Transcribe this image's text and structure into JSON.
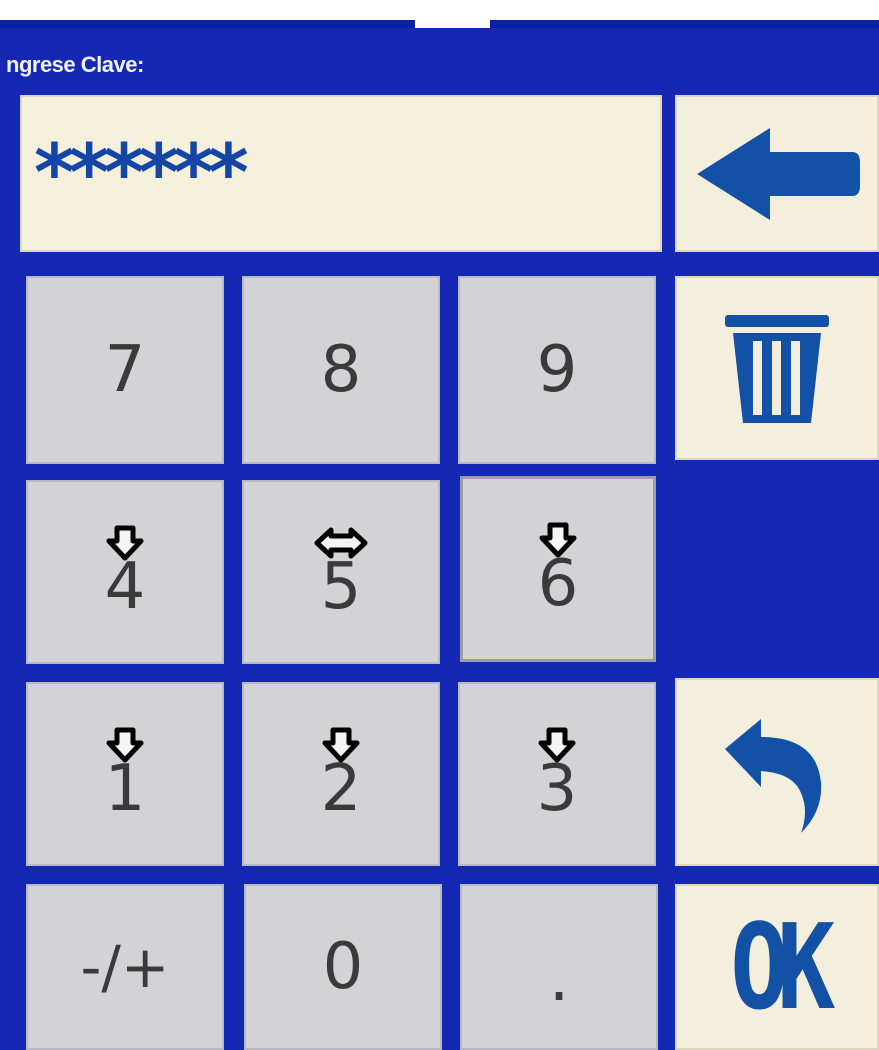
{
  "header": {
    "label": "ngrese Clave:"
  },
  "password": {
    "value": "******"
  },
  "keypad": {
    "row1": [
      {
        "label": "7"
      },
      {
        "label": "8"
      },
      {
        "label": "9"
      }
    ],
    "row2": [
      {
        "label": "4"
      },
      {
        "label": "5"
      },
      {
        "label": "6"
      }
    ],
    "row3": [
      {
        "label": "1"
      },
      {
        "label": "2"
      },
      {
        "label": "3"
      }
    ],
    "row4": [
      {
        "label": "-/+"
      },
      {
        "label": "0"
      },
      {
        "label": "."
      }
    ]
  },
  "side_buttons": {
    "backspace_icon": "left-arrow-icon",
    "clear_icon": "trash-icon",
    "undo_icon": "undo-arrow-icon",
    "ok_label": "OK"
  },
  "colors": {
    "background": "#1428b4",
    "key": "#d3d3d6",
    "cream": "#f3efdc",
    "accent": "#1351a6"
  }
}
